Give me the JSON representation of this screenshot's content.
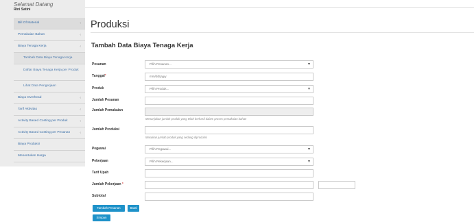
{
  "sidebar": {
    "welcome": "Selamat Datang",
    "username": "Rini Satini",
    "items": [
      {
        "label": "Bill Of Material",
        "arrow": "‹"
      },
      {
        "label": "Pemakaian Bahan",
        "arrow": "‹"
      },
      {
        "label": "Biaya Tenaga Kerja",
        "arrow": "‹"
      },
      {
        "label": "Tambah Data Biaya Tenaga Kerja"
      },
      {
        "label": "Daftar Biaya Tenaga Kerja per Produk"
      },
      {
        "label": "Lihat Data Pengerjaan"
      },
      {
        "label": "Biaya Overhead",
        "arrow": "‹"
      },
      {
        "label": "Tarif Aktivitas",
        "arrow": "‹"
      },
      {
        "label": "Activity Based Costing per Produk",
        "arrow": "‹"
      },
      {
        "label": "Activity Based Costing per Pesanan",
        "arrow": "‹"
      },
      {
        "label": "Biaya Produksi"
      },
      {
        "label": "Menentukan Harga"
      }
    ]
  },
  "main": {
    "page_title": "Produksi",
    "form_title": "Tambah Data Biaya Tenaga Kerja"
  },
  "form": {
    "pesanan": {
      "label": "Pesanan",
      "placeholder": "Pilih Pesanan..."
    },
    "tanggal": {
      "label": "Tanggal",
      "required": "*",
      "placeholder": "mm/dd/yyyy"
    },
    "produk": {
      "label": "Produk",
      "placeholder": "Pilih Produk..."
    },
    "jumlah_pesanan": {
      "label": "Jumlah Pesanan",
      "value": ""
    },
    "jumlah_pemakaian": {
      "label": "Jumlah Pemakaian",
      "value": "",
      "help": "Menunjukan jumlah produk yang telah berhasil dalam proses pemakaian bahan"
    },
    "jumlah_produksi": {
      "label": "Jumlah Produksi",
      "value": "",
      "help": "Masukan jumlah produk yang sedang diproduksi"
    },
    "pegawai": {
      "label": "Pegawai",
      "placeholder": "Pilih Pegawai..."
    },
    "pekerjaan": {
      "label": "Pekerjaan",
      "placeholder": "Pilih Pekerjaan..."
    },
    "tarif_upah": {
      "label": "Tarif Upah",
      "value": ""
    },
    "jumlah_pekerjaan": {
      "label": "Jumlah Pekerjaan",
      "required": "*",
      "value": ""
    },
    "subtotal": {
      "label": "Subtotal",
      "value": ""
    }
  },
  "buttons": {
    "tambah_pesanan": "Tambah Pesanan",
    "batal": "Batal",
    "simpan": "Simpan"
  },
  "colors": {
    "sidebar_bg": "#ececec",
    "link": "#3b6fa8",
    "button": "#1e92c9",
    "required": "#d9534f"
  }
}
